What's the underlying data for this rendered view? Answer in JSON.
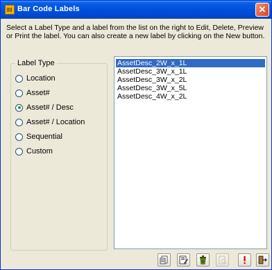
{
  "window": {
    "title": "Bar Code Labels",
    "close_glyph": "✕"
  },
  "instructions": "Select a Label Type and a label from the list on the right to Edit, Delete, Preview or Print the label. You can also create a new label by clicking on the New button.",
  "label_type": {
    "legend": "Label Type",
    "selected": "Asset# / Desc",
    "options": [
      {
        "label": "Location",
        "checked": false
      },
      {
        "label": "Asset#",
        "checked": false
      },
      {
        "label": "Asset# / Desc",
        "checked": true
      },
      {
        "label": "Asset# / Location",
        "checked": false
      },
      {
        "label": "Sequential",
        "checked": false
      },
      {
        "label": "Custom",
        "checked": false
      }
    ]
  },
  "labels_list": {
    "items": [
      {
        "label": "AssetDesc_2W_x_1L",
        "selected": true
      },
      {
        "label": "AssetDesc_3W_x_1L",
        "selected": false
      },
      {
        "label": "AssetDesc_3W_x_2L",
        "selected": false
      },
      {
        "label": "AssetDesc_3W_x_5L",
        "selected": false
      },
      {
        "label": "AssetDesc_4W_x_2L",
        "selected": false
      }
    ]
  },
  "toolbar": {
    "buttons": [
      {
        "icon": "new-label-icon",
        "enabled": true
      },
      {
        "icon": "edit-label-icon",
        "enabled": true
      },
      {
        "icon": "delete-icon",
        "enabled": true
      },
      {
        "icon": "preview-icon",
        "enabled": false
      },
      {
        "icon": "print-icon",
        "enabled": true
      },
      {
        "icon": "exit-icon",
        "enabled": true
      }
    ]
  },
  "colors": {
    "titlebar": "#0050dd",
    "selection": "#316ac5",
    "window_bg": "#ece9d8",
    "close_button": "#d94520"
  }
}
